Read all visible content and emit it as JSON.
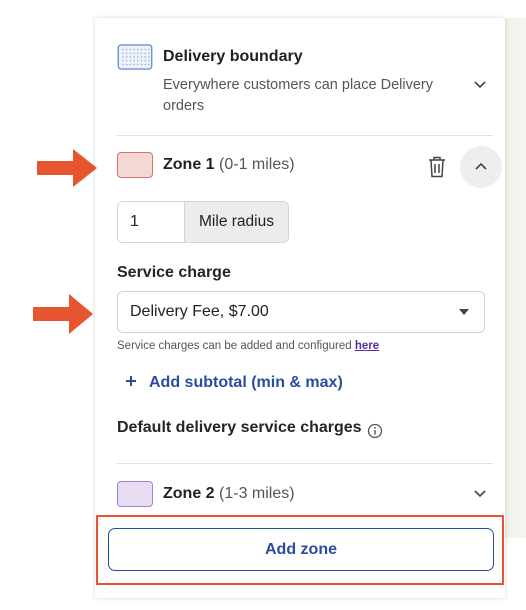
{
  "delivery_boundary": {
    "title": "Delivery boundary",
    "subtitle": "Everywhere customers can place Delivery orders"
  },
  "zone1": {
    "name": "Zone 1",
    "range": "(0-1 miles)",
    "color": "#f3d8d4",
    "radius_value": "1",
    "radius_unit": "Mile radius",
    "service_charge_label": "Service charge",
    "service_charge_value": "Delivery Fee, $7.00",
    "help_text": "Service charges can be added and configured",
    "help_link": "here",
    "add_subtotal": "Add subtotal (min & max)",
    "default_charges_label": "Default delivery service charges"
  },
  "zone2": {
    "name": "Zone 2",
    "range": "(1-3 miles)",
    "color": "#e8dcf2"
  },
  "add_zone_label": "Add zone",
  "colors": {
    "accent_blue": "#2b4c9e",
    "arrow_orange": "#e6552f",
    "link_purple": "#5b2aa6"
  },
  "icons": {
    "boundary_swatch": "dotted-map-swatch-icon",
    "trash": "trash-icon",
    "chevron_up": "chevron-up-icon",
    "chevron_down": "chevron-down-icon",
    "info": "info-icon",
    "plus": "plus-icon",
    "arrow": "arrow-right-icon"
  }
}
